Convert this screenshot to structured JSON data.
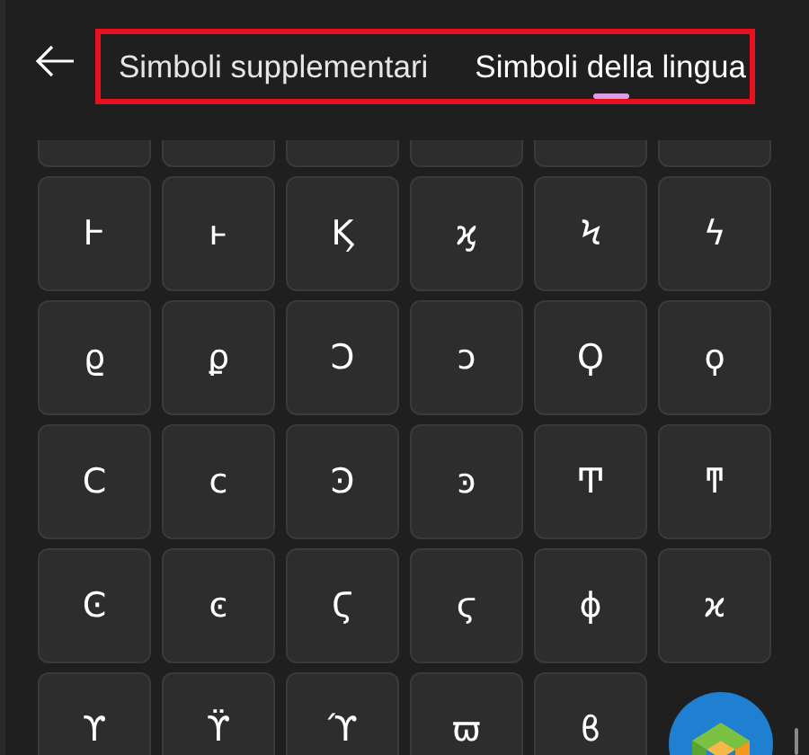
{
  "tabs": [
    {
      "label": "Simboli supplementari",
      "selected": false
    },
    {
      "label": "Simboli della lingua",
      "selected": true
    }
  ],
  "symbol_rows": [
    [
      "Ͱ",
      "ͱ",
      "Ϗ",
      "ϗ",
      "Ϟ",
      "ϟ"
    ],
    [
      "ϱ",
      "ϼ",
      "Ͻ",
      "ͻ",
      "Ϙ",
      "ϙ"
    ],
    [
      "Ϲ",
      "ϲ",
      "Ͽ",
      "ͽ",
      "Ͳ",
      "ͳ"
    ],
    [
      "Ͼ",
      "ͼ",
      "Ϛ",
      "ϛ",
      "ϕ",
      "ϰ"
    ],
    [
      "ϒ",
      "ϔ",
      "ϓ",
      "ϖ",
      "ϐ"
    ]
  ]
}
